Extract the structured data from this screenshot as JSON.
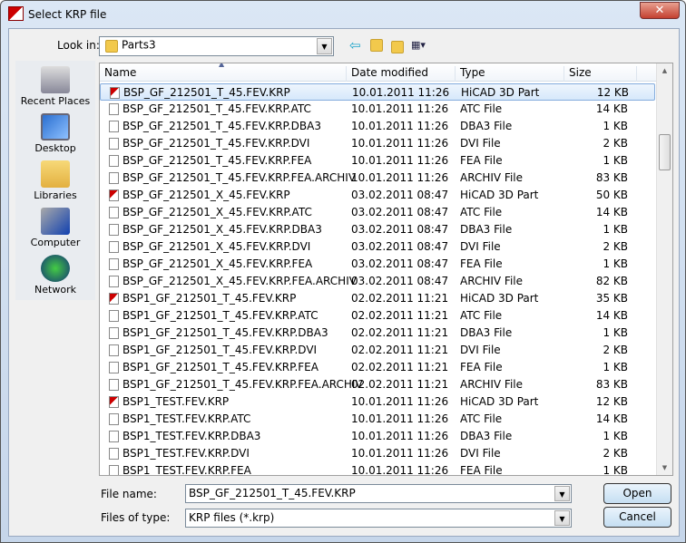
{
  "window": {
    "title": "Select KRP file",
    "close_label": "✕"
  },
  "toolbar": {
    "look_in_label": "Look in:",
    "look_in_value": "Parts3",
    "icons": [
      "back-arrow-icon",
      "up-folder-icon",
      "new-folder-icon",
      "view-menu-icon"
    ]
  },
  "places": [
    {
      "label": "Recent Places",
      "icon": "recent-places-icon"
    },
    {
      "label": "Desktop",
      "icon": "desktop-icon"
    },
    {
      "label": "Libraries",
      "icon": "libraries-icon"
    },
    {
      "label": "Computer",
      "icon": "computer-icon"
    },
    {
      "label": "Network",
      "icon": "network-icon"
    }
  ],
  "columns": [
    "Name",
    "Date modified",
    "Type",
    "Size"
  ],
  "files": [
    [
      "BSP_GF_212501_T_45.FEV.KRP",
      "10.01.2011 11:26",
      "HiCAD 3D Part",
      "12 KB"
    ],
    [
      "BSP_GF_212501_T_45.FEV.KRP.ATC",
      "10.01.2011 11:26",
      "ATC File",
      "14 KB"
    ],
    [
      "BSP_GF_212501_T_45.FEV.KRP.DBA3",
      "10.01.2011 11:26",
      "DBA3 File",
      "1 KB"
    ],
    [
      "BSP_GF_212501_T_45.FEV.KRP.DVI",
      "10.01.2011 11:26",
      "DVI File",
      "2 KB"
    ],
    [
      "BSP_GF_212501_T_45.FEV.KRP.FEA",
      "10.01.2011 11:26",
      "FEA File",
      "1 KB"
    ],
    [
      "BSP_GF_212501_T_45.FEV.KRP.FEA.ARCHIV",
      "10.01.2011 11:26",
      "ARCHIV File",
      "83 KB"
    ],
    [
      "BSP_GF_212501_X_45.FEV.KRP",
      "03.02.2011 08:47",
      "HiCAD 3D Part",
      "50 KB"
    ],
    [
      "BSP_GF_212501_X_45.FEV.KRP.ATC",
      "03.02.2011 08:47",
      "ATC File",
      "14 KB"
    ],
    [
      "BSP_GF_212501_X_45.FEV.KRP.DBA3",
      "03.02.2011 08:47",
      "DBA3 File",
      "1 KB"
    ],
    [
      "BSP_GF_212501_X_45.FEV.KRP.DVI",
      "03.02.2011 08:47",
      "DVI File",
      "2 KB"
    ],
    [
      "BSP_GF_212501_X_45.FEV.KRP.FEA",
      "03.02.2011 08:47",
      "FEA File",
      "1 KB"
    ],
    [
      "BSP_GF_212501_X_45.FEV.KRP.FEA.ARCHIV",
      "03.02.2011 08:47",
      "ARCHIV File",
      "82 KB"
    ],
    [
      "BSP1_GF_212501_T_45.FEV.KRP",
      "02.02.2011 11:21",
      "HiCAD 3D Part",
      "35 KB"
    ],
    [
      "BSP1_GF_212501_T_45.FEV.KRP.ATC",
      "02.02.2011 11:21",
      "ATC File",
      "14 KB"
    ],
    [
      "BSP1_GF_212501_T_45.FEV.KRP.DBA3",
      "02.02.2011 11:21",
      "DBA3 File",
      "1 KB"
    ],
    [
      "BSP1_GF_212501_T_45.FEV.KRP.DVI",
      "02.02.2011 11:21",
      "DVI File",
      "2 KB"
    ],
    [
      "BSP1_GF_212501_T_45.FEV.KRP.FEA",
      "02.02.2011 11:21",
      "FEA File",
      "1 KB"
    ],
    [
      "BSP1_GF_212501_T_45.FEV.KRP.FEA.ARCHIV",
      "02.02.2011 11:21",
      "ARCHIV File",
      "83 KB"
    ],
    [
      "BSP1_TEST.FEV.KRP",
      "10.01.2011 11:26",
      "HiCAD 3D Part",
      "12 KB"
    ],
    [
      "BSP1_TEST.FEV.KRP.ATC",
      "10.01.2011 11:26",
      "ATC File",
      "14 KB"
    ],
    [
      "BSP1_TEST.FEV.KRP.DBA3",
      "10.01.2011 11:26",
      "DBA3 File",
      "1 KB"
    ],
    [
      "BSP1_TEST.FEV.KRP.DVI",
      "10.01.2011 11:26",
      "DVI File",
      "2 KB"
    ],
    [
      "BSP1_TEST.FEV.KRP.FEA",
      "10.01.2011 11:26",
      "FEA File",
      "1 KB"
    ]
  ],
  "selected_index": 0,
  "footer": {
    "file_name_label": "File name:",
    "file_name_value": "BSP_GF_212501_T_45.FEV.KRP",
    "type_label": "Files of type:",
    "type_value": "KRP files (*.krp)",
    "open_label": "Open",
    "cancel_label": "Cancel"
  }
}
